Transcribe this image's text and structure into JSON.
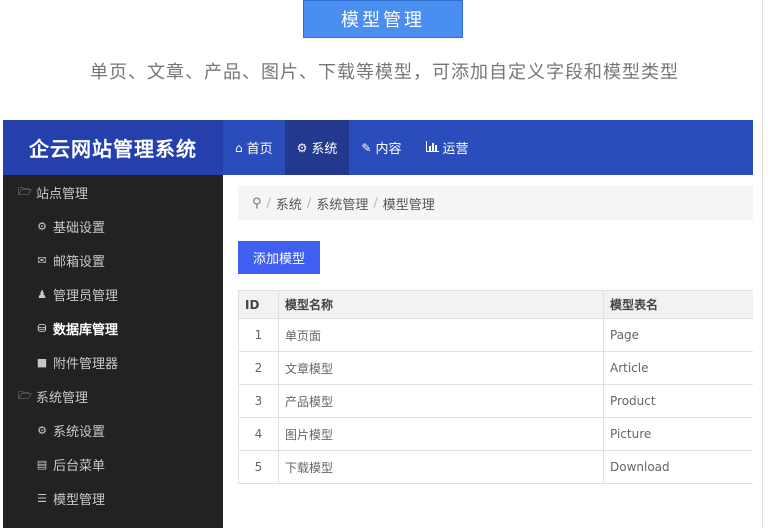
{
  "promo": {
    "badge": "模型管理",
    "subtitle": "单页、文章、产品、图片、下载等模型，可添加自定义字段和模型类型"
  },
  "app": {
    "brand": "企云网站管理系统",
    "nav": [
      {
        "label": "首页",
        "icon": "home-icon"
      },
      {
        "label": "系统",
        "icon": "cogs-icon"
      },
      {
        "label": "内容",
        "icon": "edit-icon"
      },
      {
        "label": "运营",
        "icon": "bar-chart-icon"
      }
    ],
    "sidebar": [
      {
        "label": "站点管理",
        "icon": "folder-open-icon",
        "type": "group"
      },
      {
        "label": "基础设置",
        "icon": "gear-icon",
        "type": "item"
      },
      {
        "label": "邮箱设置",
        "icon": "envelope-icon",
        "type": "item"
      },
      {
        "label": "管理员管理",
        "icon": "user-icon",
        "type": "item"
      },
      {
        "label": "数据库管理",
        "icon": "database-icon",
        "type": "item",
        "active": true
      },
      {
        "label": "附件管理器",
        "icon": "folder-icon",
        "type": "item"
      },
      {
        "label": "系统管理",
        "icon": "folder-open-icon",
        "type": "group"
      },
      {
        "label": "系统设置",
        "icon": "cogs-icon",
        "type": "item"
      },
      {
        "label": "后台菜单",
        "icon": "list-alt-icon",
        "type": "item"
      },
      {
        "label": "模型管理",
        "icon": "bars-icon",
        "type": "item"
      }
    ],
    "breadcrumb": [
      "系统",
      "系统管理",
      "模型管理"
    ],
    "add_button": "添加模型",
    "table": {
      "headers": [
        "ID",
        "模型名称",
        "模型表名"
      ],
      "rows": [
        {
          "id": "1",
          "name": "单页面",
          "table": "Page"
        },
        {
          "id": "2",
          "name": "文章模型",
          "table": "Article"
        },
        {
          "id": "3",
          "name": "产品模型",
          "table": "Product"
        },
        {
          "id": "4",
          "name": "图片模型",
          "table": "Picture"
        },
        {
          "id": "5",
          "name": "下载模型",
          "table": "Download"
        }
      ]
    }
  },
  "colors": {
    "topbar": "#2b4cbb",
    "brand_bg": "#2540ad",
    "nav_active": "#22398f",
    "sidebar_bg": "#222222",
    "button": "#3e5ff0",
    "badge": "#4a8ef0"
  }
}
